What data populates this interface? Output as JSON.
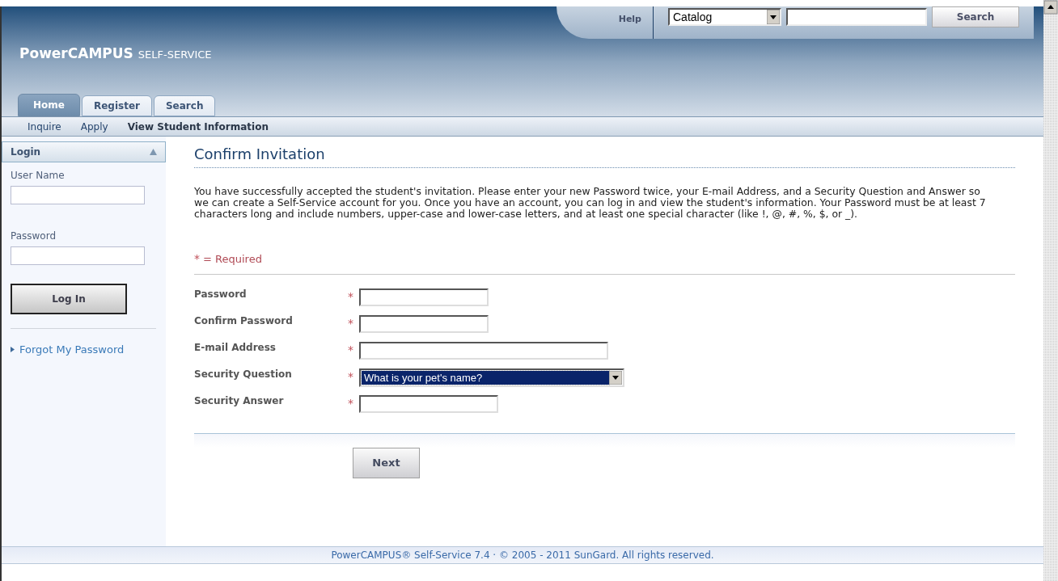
{
  "header": {
    "logo_main": "PowerCAMPUS",
    "logo_sub": "SELF-SERVICE",
    "help": "Help",
    "search_scope": "Catalog",
    "search_button": "Search"
  },
  "tabs": [
    {
      "label": "Home",
      "selected": true
    },
    {
      "label": "Register",
      "selected": false
    },
    {
      "label": "Search",
      "selected": false
    }
  ],
  "subnav": [
    {
      "label": "Inquire",
      "selected": false
    },
    {
      "label": "Apply",
      "selected": false
    },
    {
      "label": "View Student Information",
      "selected": true
    }
  ],
  "login": {
    "title": "Login",
    "user_name_label": "User Name",
    "password_label": "Password",
    "button": "Log In",
    "forgot_link": "Forgot My Password"
  },
  "content": {
    "title": "Confirm Invitation",
    "intro": "You have successfully accepted the student's invitation. Please enter your new Password twice, your E-mail Address, and a Security Question and Answer so we can create a Self-Service account for you. Once you have an account, you can log in and view the student's information. Your Password must be at least 7 characters long and include numbers, upper-case and lower-case letters, and at least one special character (like !, @, #, %, $, or _).",
    "required_mark": "*",
    "required_note": "= Required",
    "fields": [
      {
        "label": "Password",
        "kind": "text",
        "required": true
      },
      {
        "label": "Confirm Password",
        "kind": "text",
        "required": true
      },
      {
        "label": "E-mail Address",
        "kind": "text",
        "required": true
      },
      {
        "label": "Security Question",
        "kind": "select",
        "required": true,
        "value": "What is your pet's name?"
      },
      {
        "label": "Security Answer",
        "kind": "text",
        "required": true
      }
    ],
    "next_button": "Next"
  },
  "footer": "PowerCAMPUS® Self-Service 7.4 · © 2005 - 2011 SunGard. All rights reserved."
}
